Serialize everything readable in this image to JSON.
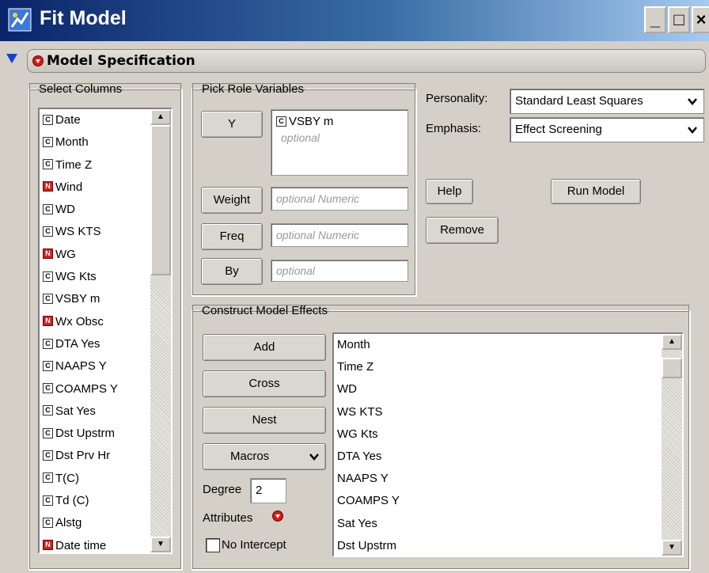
{
  "window": {
    "title": "Fit Model"
  },
  "section": {
    "title": "Model Specification"
  },
  "select_columns": {
    "legend": "Select Columns",
    "items": [
      {
        "type": "C",
        "label": "Date"
      },
      {
        "type": "C",
        "label": "Month"
      },
      {
        "type": "C",
        "label": "Time Z"
      },
      {
        "type": "N",
        "label": "Wind"
      },
      {
        "type": "C",
        "label": "WD"
      },
      {
        "type": "C",
        "label": "WS KTS"
      },
      {
        "type": "N",
        "label": "WG"
      },
      {
        "type": "C",
        "label": "WG Kts"
      },
      {
        "type": "C",
        "label": "VSBY m"
      },
      {
        "type": "N",
        "label": "Wx Obsc"
      },
      {
        "type": "C",
        "label": "DTA Yes"
      },
      {
        "type": "C",
        "label": "NAAPS Y"
      },
      {
        "type": "C",
        "label": "COAMPS Y"
      },
      {
        "type": "C",
        "label": "Sat Yes"
      },
      {
        "type": "C",
        "label": "Dst Upstrm"
      },
      {
        "type": "C",
        "label": "Dst Prv Hr"
      },
      {
        "type": "C",
        "label": "T(C)"
      },
      {
        "type": "C",
        "label": "Td (C)"
      },
      {
        "type": "C",
        "label": "Alstg"
      },
      {
        "type": "N",
        "label": "Date time"
      }
    ]
  },
  "pick_role": {
    "legend": "Pick Role Variables",
    "y_label": "Y",
    "y_value": "VSBY m",
    "y_placeholder": "optional",
    "weight_label": "Weight",
    "weight_placeholder": "optional Numeric",
    "freq_label": "Freq",
    "freq_placeholder": "optional Numeric",
    "by_label": "By",
    "by_placeholder": "optional"
  },
  "personality": {
    "label": "Personality:",
    "value": "Standard Least Squares"
  },
  "emphasis": {
    "label": "Emphasis:",
    "value": "Effect Screening"
  },
  "buttons": {
    "help": "Help",
    "run_model": "Run Model",
    "remove": "Remove"
  },
  "construct": {
    "legend": "Construct Model Effects",
    "add": "Add",
    "cross": "Cross",
    "nest": "Nest",
    "macros": "Macros",
    "degree_label": "Degree",
    "degree_value": "2",
    "attributes_label": "Attributes",
    "no_intercept_label": "No Intercept",
    "effects": [
      "Month",
      "Time Z",
      "WD",
      "WS KTS",
      "WG Kts",
      "DTA Yes",
      "NAAPS Y",
      "COAMPS Y",
      "Sat Yes",
      "Dst Upstrm"
    ]
  },
  "icons": {
    "tag_c": "C",
    "tag_n": "N",
    "minimize": "_",
    "maximize": "□",
    "close": "×",
    "scroll_up": "▲",
    "scroll_down": "▼",
    "dropdown": "❯"
  },
  "colors": {
    "title_start": "#0a246a",
    "title_end": "#a6caf0",
    "panel": "#d4d0c8",
    "nominal_tag": "#c22"
  }
}
